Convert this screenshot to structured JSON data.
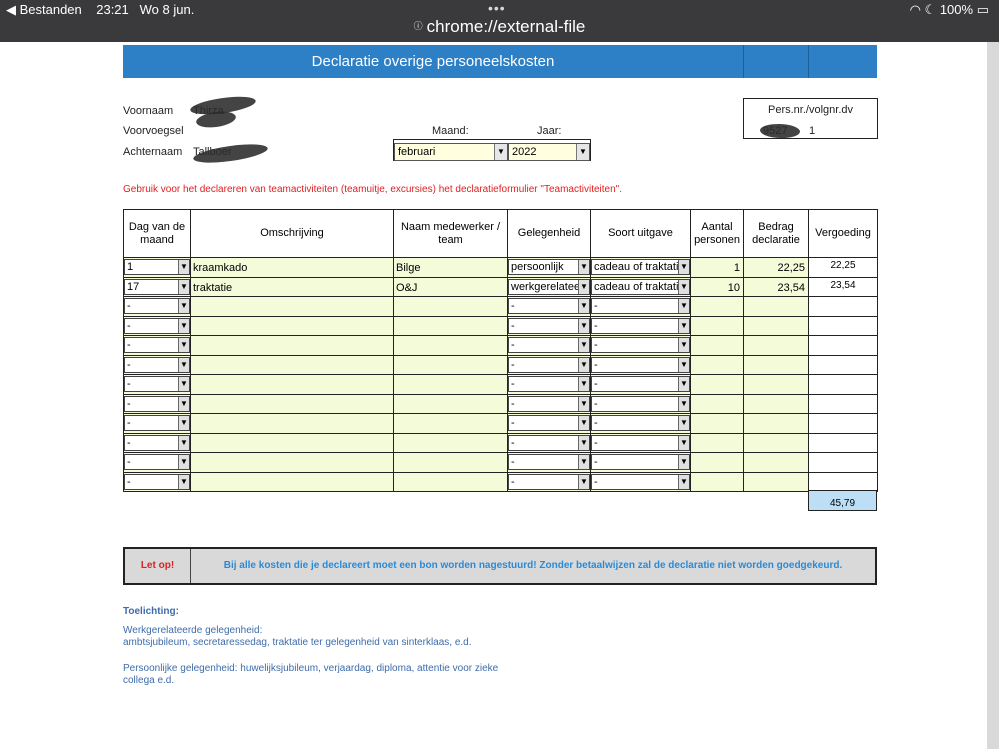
{
  "status_bar": {
    "back_app": "◀ Bestanden",
    "time": "23:21",
    "date": "Wo 8 jun.",
    "battery": "100%",
    "dots": "•••"
  },
  "browser": {
    "url": "chrome://external-file"
  },
  "form": {
    "title": "Declaratie overige personeelskosten",
    "labels": {
      "voornaam": "Voornaam",
      "voorvoegsel": "Voorvoegsel",
      "achternaam": "Achternaam",
      "maand": "Maand:",
      "jaar": "Jaar:",
      "persnr": "Pers.nr./volgnr.dv"
    },
    "values": {
      "voornaam": "Thirza",
      "achternaam": "Tallboer",
      "maand": "februari",
      "jaar": "2022",
      "persnr": "9527",
      "volgnr": "1"
    },
    "warning": "Gebruik voor het declareren van teamactiviteiten (teamuitje, excursies) het declaratieformulier \"Teamactiviteiten\".",
    "columns": [
      "Dag van de maand",
      "Omschrijving",
      "Naam medewerker / team",
      "Gelegenheid",
      "Soort uitgave",
      "Aantal personen",
      "Bedrag declaratie",
      "Vergoeding"
    ],
    "rows": [
      {
        "dag": "1",
        "omschrijving": "kraamkado",
        "naam": "Bilge",
        "gelegenheid": "persoonlijk",
        "soort": "cadeau of traktatie",
        "aantal": "1",
        "bedrag": "22,25",
        "vergoeding": "22,25"
      },
      {
        "dag": "17",
        "omschrijving": "traktatie",
        "naam": "O&J",
        "gelegenheid": "werkgerelateerd",
        "soort": "cadeau of traktatie",
        "aantal": "10",
        "bedrag": "23,54",
        "vergoeding": "23,54"
      },
      {
        "dag": "-",
        "omschrijving": "",
        "naam": "",
        "gelegenheid": "-",
        "soort": "-",
        "aantal": "",
        "bedrag": "",
        "vergoeding": ""
      },
      {
        "dag": "-",
        "omschrijving": "",
        "naam": "",
        "gelegenheid": "-",
        "soort": "-",
        "aantal": "",
        "bedrag": "",
        "vergoeding": ""
      },
      {
        "dag": "-",
        "omschrijving": "",
        "naam": "",
        "gelegenheid": "-",
        "soort": "-",
        "aantal": "",
        "bedrag": "",
        "vergoeding": ""
      },
      {
        "dag": "-",
        "omschrijving": "",
        "naam": "",
        "gelegenheid": "-",
        "soort": "-",
        "aantal": "",
        "bedrag": "",
        "vergoeding": ""
      },
      {
        "dag": "-",
        "omschrijving": "",
        "naam": "",
        "gelegenheid": "-",
        "soort": "-",
        "aantal": "",
        "bedrag": "",
        "vergoeding": ""
      },
      {
        "dag": "-",
        "omschrijving": "",
        "naam": "",
        "gelegenheid": "-",
        "soort": "-",
        "aantal": "",
        "bedrag": "",
        "vergoeding": ""
      },
      {
        "dag": "-",
        "omschrijving": "",
        "naam": "",
        "gelegenheid": "-",
        "soort": "-",
        "aantal": "",
        "bedrag": "",
        "vergoeding": ""
      },
      {
        "dag": "-",
        "omschrijving": "",
        "naam": "",
        "gelegenheid": "-",
        "soort": "-",
        "aantal": "",
        "bedrag": "",
        "vergoeding": ""
      },
      {
        "dag": "-",
        "omschrijving": "",
        "naam": "",
        "gelegenheid": "-",
        "soort": "-",
        "aantal": "",
        "bedrag": "",
        "vergoeding": ""
      },
      {
        "dag": "-",
        "omschrijving": "",
        "naam": "",
        "gelegenheid": "-",
        "soort": "-",
        "aantal": "",
        "bedrag": "",
        "vergoeding": ""
      }
    ],
    "total": "45,79",
    "letop_label": "Let op!",
    "letop_message": "Bij alle kosten die je declareert moet een bon worden nagestuurd! Zonder betaalwijzen zal de declaratie niet worden goedgekeurd.",
    "toelichting_title": "Toelichting:",
    "toelichting_werk_1": "Werkgerelateerde gelegenheid:",
    "toelichting_werk_2": "ambtsjubileum, secretaressedag, traktatie ter gelegenheid van sinterklaas, e.d.",
    "toelichting_pers_1": "Persoonlijke gelegenheid: huwelijksjubileum, verjaardag, diploma, attentie voor zieke",
    "toelichting_pers_2": "collega e.d."
  },
  "colors": {
    "header_blue": "#2d7fc6",
    "input_yellow": "#f3fbd9",
    "warning_red": "#e02020",
    "total_blue": "#bcdff5",
    "note_blue": "#3d6cab"
  }
}
